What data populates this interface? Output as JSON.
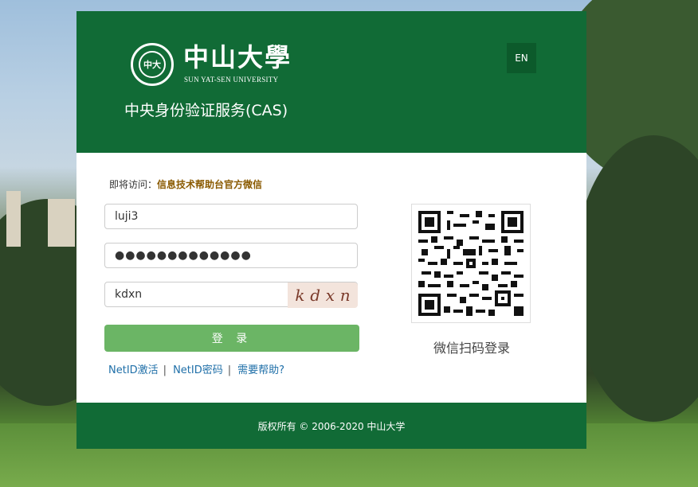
{
  "header": {
    "logo_cn": "中山大學",
    "logo_en": "SUN YAT-SEN UNIVERSITY",
    "seal_text": "中大",
    "service_title": "中央身份验证服务(CAS)",
    "lang_button": "EN"
  },
  "visit": {
    "prefix": "即将访问：",
    "target": "信息技术帮助台官方微信"
  },
  "form": {
    "username": "luji3",
    "password": "●●●●●●●●●●●●●",
    "captcha_value": "kdxn",
    "captcha_chars": [
      "k",
      "d",
      "x",
      "n"
    ],
    "login_label": "登 录"
  },
  "links": {
    "activate": "NetID激活",
    "password": "NetID密码",
    "help": "需要帮助?",
    "separator": "|"
  },
  "qr": {
    "label": "微信扫码登录"
  },
  "footer": {
    "copyright": "版权所有 © 2006-2020 中山大学"
  },
  "colors": {
    "brand_green": "#116b36",
    "button_green": "#6bb565",
    "link_blue": "#1f6fa8",
    "visit_target": "#8a5a00"
  }
}
